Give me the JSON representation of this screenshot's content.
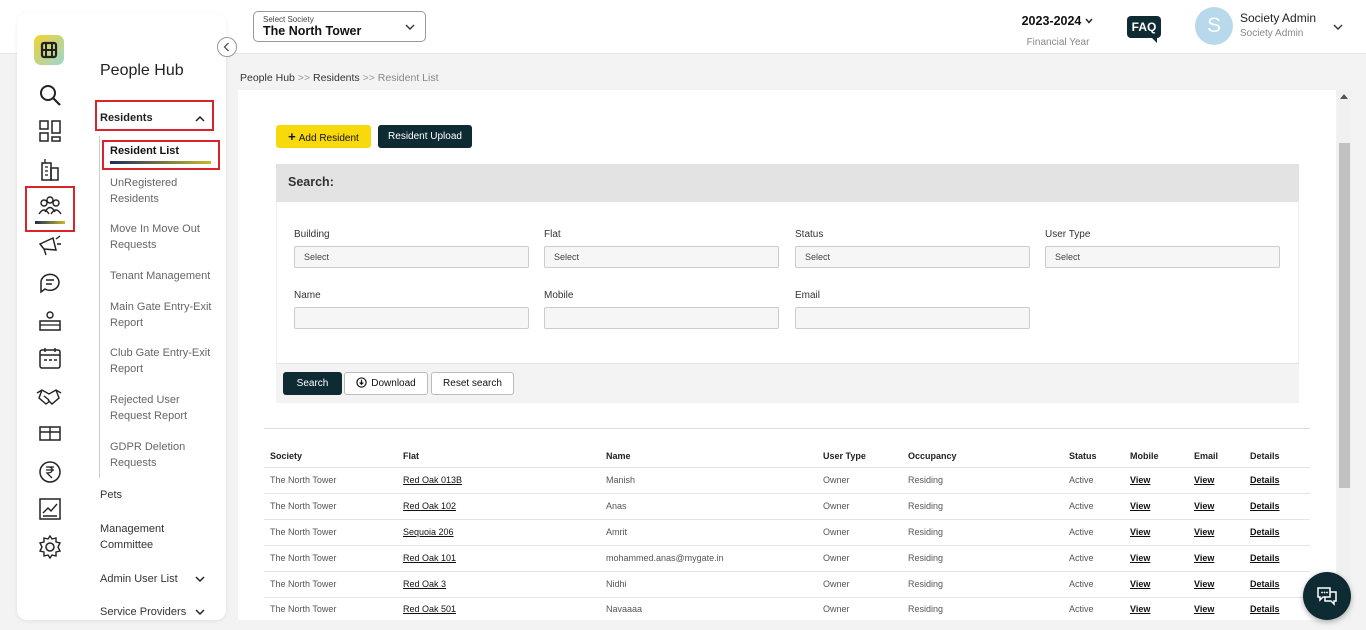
{
  "header": {
    "society_label": "Select Society",
    "society_value": "The North Tower",
    "financial_year": "2023-2024",
    "financial_year_label": "Financial Year",
    "faq": "FAQ",
    "avatar_letter": "S",
    "user_name": "Society Admin",
    "user_role": "Society Admin"
  },
  "sidebar": {
    "title": "People Hub",
    "residents": "Residents",
    "sub_items": {
      "resident_list": "Resident List",
      "unregistered": "UnRegistered Residents",
      "move_in_out": "Move In Move Out Requests",
      "tenant": "Tenant Management",
      "main_gate": "Main Gate Entry-Exit Report",
      "club_gate": "Club Gate Entry-Exit Report",
      "rejected": "Rejected User Request Report",
      "gdpr": "GDPR Deletion Requests"
    },
    "pets": "Pets",
    "management_committee": "Management Committee",
    "admin_user_list": "Admin User List",
    "service_providers": "Service Providers"
  },
  "breadcrumb": {
    "hub": "People Hub",
    "sep1": " >> ",
    "residents": "Residents",
    "sep2": " >> ",
    "current": "Resident List"
  },
  "toolbar": {
    "add_resident": "Add Resident",
    "resident_upload": "Resident Upload"
  },
  "search": {
    "heading": "Search:",
    "building_label": "Building",
    "building_value": "Select",
    "flat_label": "Flat",
    "flat_value": "Select",
    "status_label": "Status",
    "status_value": "Select",
    "user_type_label": "User Type",
    "user_type_value": "Select",
    "name_label": "Name",
    "mobile_label": "Mobile",
    "email_label": "Email",
    "search_button": "Search",
    "download_button": "Download",
    "reset_button": "Reset search"
  },
  "table": {
    "headers": [
      "Society",
      "Flat",
      "Name",
      "User Type",
      "Occupancy",
      "Status",
      "Mobile",
      "Email",
      "Details"
    ],
    "rows": [
      [
        "The North Tower",
        "Red Oak 013B",
        "Manish",
        "Owner",
        "Residing",
        "Active",
        "View",
        "View",
        "Details"
      ],
      [
        "The North Tower",
        "Red Oak 102",
        "Anas",
        "Owner",
        "Residing",
        "Active",
        "View",
        "View",
        "Details"
      ],
      [
        "The North Tower",
        "Sequoia 206",
        "Amrit",
        "Owner",
        "Residing",
        "Active",
        "View",
        "View",
        "Details"
      ],
      [
        "The North Tower",
        "Red Oak 101",
        "mohammed.anas@mygate.in",
        "Owner",
        "Residing",
        "Active",
        "View",
        "View",
        "Details"
      ],
      [
        "The North Tower",
        "Red Oak 3",
        "Nidhi",
        "Owner",
        "Residing",
        "Active",
        "View",
        "View",
        "Details"
      ],
      [
        "The North Tower",
        "Red Oak 501",
        "Navaaaa",
        "Owner",
        "Residing",
        "Active",
        "View",
        "View",
        "Details"
      ]
    ]
  },
  "colors": {
    "accent_dark": "#0e2a33",
    "accent_yellow": "#f8d90c",
    "highlight_red": "#d9242b"
  },
  "icons": [
    "logo-icon",
    "search-icon",
    "dashboard-icon",
    "building-icon",
    "people-icon",
    "megaphone-icon",
    "chat-icon",
    "desk-icon",
    "calendar-icon",
    "handshake-icon",
    "package-icon",
    "rupee-icon",
    "chart-icon",
    "gear-icon"
  ]
}
